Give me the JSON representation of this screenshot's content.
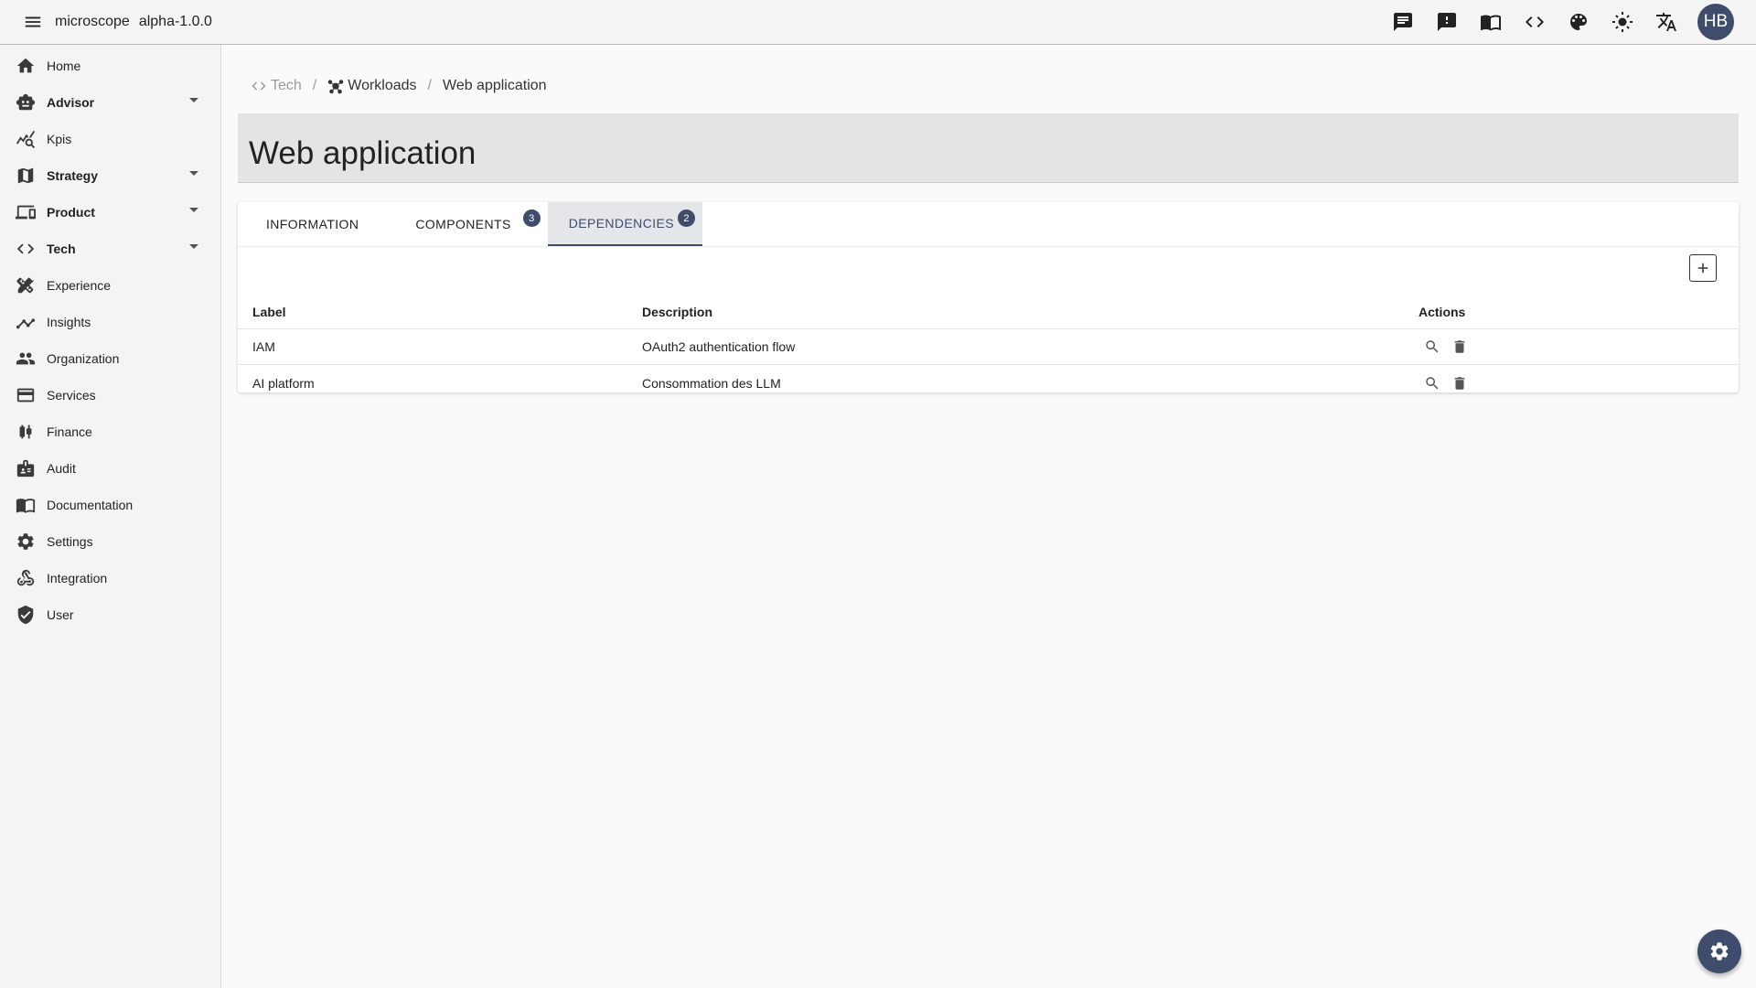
{
  "app": {
    "name": "microscope",
    "version": "alpha-1.0.0"
  },
  "header": {
    "icons": [
      "chat-icon",
      "feedback-icon",
      "book-icon",
      "code-icon",
      "palette-icon",
      "brightness-icon",
      "translate-icon"
    ],
    "avatar_initials": "HB"
  },
  "sidebar": {
    "items": [
      {
        "label": "Home",
        "icon": "home-icon"
      },
      {
        "label": "Advisor",
        "icon": "robot-icon",
        "expandable": true
      },
      {
        "label": "Kpis",
        "icon": "query-stats-icon"
      },
      {
        "label": "Strategy",
        "icon": "map-icon",
        "expandable": true
      },
      {
        "label": "Product",
        "icon": "devices-icon",
        "expandable": true
      },
      {
        "label": "Tech",
        "icon": "code-icon",
        "expandable": true
      },
      {
        "label": "Experience",
        "icon": "design-icon"
      },
      {
        "label": "Insights",
        "icon": "insights-icon"
      },
      {
        "label": "Organization",
        "icon": "people-icon"
      },
      {
        "label": "Services",
        "icon": "card-icon"
      },
      {
        "label": "Finance",
        "icon": "candlestick-icon"
      },
      {
        "label": "Audit",
        "icon": "badge-icon"
      },
      {
        "label": "Documentation",
        "icon": "book-icon"
      },
      {
        "label": "Settings",
        "icon": "gear-icon"
      },
      {
        "label": "Integration",
        "icon": "webhook-icon"
      },
      {
        "label": "User",
        "icon": "shield-icon"
      }
    ]
  },
  "breadcrumb": {
    "items": [
      {
        "label": "Tech",
        "icon": "code-icon"
      },
      {
        "label": "Workloads",
        "icon": "hub-icon"
      },
      {
        "label": "Web application"
      }
    ],
    "separator": "/"
  },
  "page": {
    "title": "Web application"
  },
  "tabs": [
    {
      "label": "INFORMATION"
    },
    {
      "label": "COMPONENTS",
      "badge": "3"
    },
    {
      "label": "DEPENDENCIES",
      "badge": "2",
      "active": true
    }
  ],
  "table": {
    "headers": {
      "label": "Label",
      "description": "Description",
      "actions": "Actions"
    },
    "rows": [
      {
        "label": "IAM",
        "description": "OAuth2 authentication flow"
      },
      {
        "label": "AI platform",
        "description": "Consommation des LLM"
      }
    ]
  },
  "colors": {
    "accent": "#3f4c6b",
    "background": "#fafafa",
    "sidebar": "#f4f4f4"
  }
}
